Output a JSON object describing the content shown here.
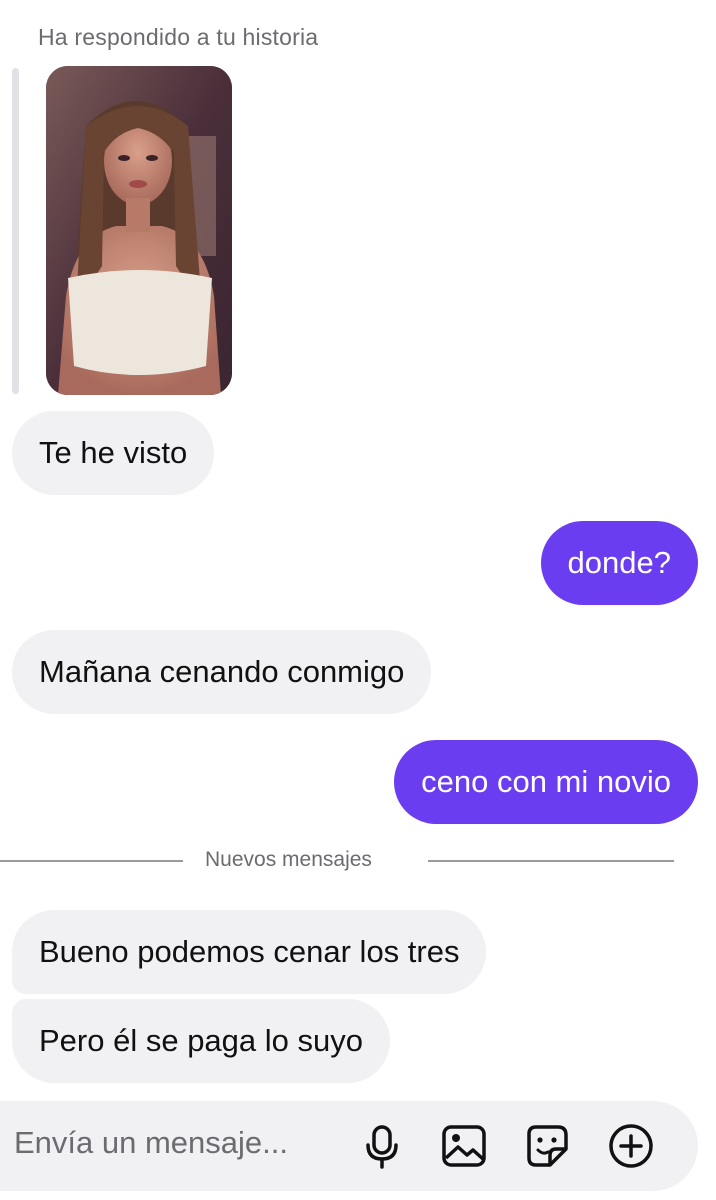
{
  "story_reply": {
    "caption": "Ha respondido a tu historia"
  },
  "messages": [
    {
      "direction": "incoming",
      "text": "Te he visto"
    },
    {
      "direction": "outgoing",
      "text": "donde?"
    },
    {
      "direction": "incoming",
      "text": "Mañana cenando conmigo"
    },
    {
      "direction": "outgoing",
      "text": "ceno con mi novio"
    }
  ],
  "divider": {
    "label": "Nuevos mensajes"
  },
  "new_messages": [
    {
      "direction": "incoming",
      "text": "Bueno podemos cenar los tres"
    },
    {
      "direction": "incoming",
      "text": "Pero él se paga lo suyo"
    }
  ],
  "composer": {
    "placeholder": "Envía un mensaje...",
    "icons": [
      "microphone-icon",
      "image-icon",
      "sticker-icon",
      "add-icon"
    ]
  },
  "colors": {
    "outgoing_bubble": "#6b3df0",
    "incoming_bubble": "#f1f1f4",
    "muted_text": "#6b6b70"
  }
}
